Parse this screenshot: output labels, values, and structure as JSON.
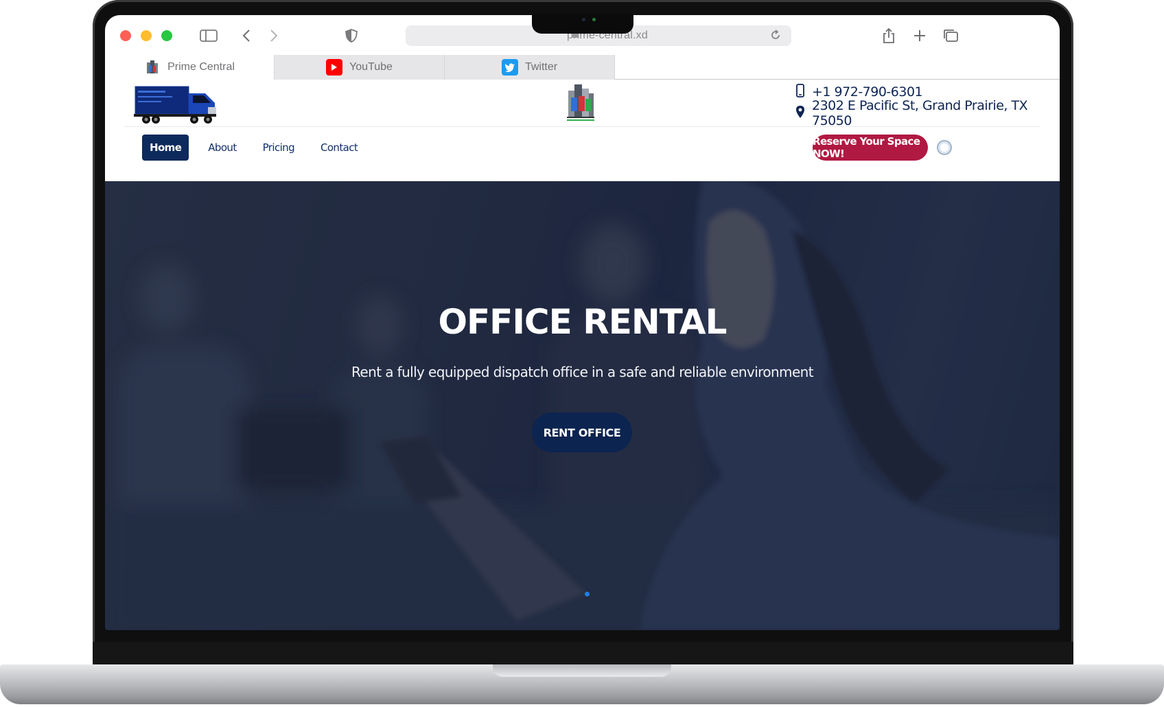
{
  "browser": {
    "url": "prime-central.xd",
    "tabs": [
      {
        "label": "Prime Central",
        "icon": "prime-central-favicon",
        "active": true
      },
      {
        "label": "YouTube",
        "icon": "youtube-favicon",
        "active": false,
        "color": "#ff0000"
      },
      {
        "label": "Twitter",
        "icon": "twitter-favicon",
        "active": false,
        "color": "#1d9bf0"
      }
    ],
    "traffic_lights": [
      "#ff5f57",
      "#febc2e",
      "#28c840"
    ]
  },
  "header": {
    "phone": "+1 972-790-6301",
    "address": "2302 E Pacific St, Grand Prairie, TX 75050",
    "nav": [
      {
        "label": "Home",
        "active": true
      },
      {
        "label": "About",
        "active": false
      },
      {
        "label": "Pricing",
        "active": false
      },
      {
        "label": "Contact",
        "active": false
      }
    ],
    "cta_label": "Reserve Your Space NOW!",
    "cta_color": "#b01942",
    "brand_color": "#0d2a5c"
  },
  "hero": {
    "title": "OFFICE RENTAL",
    "subtitle": "Rent a fully equipped dispatch office in a safe and reliable environment",
    "button_label": "RENT OFFICE",
    "slide_indicator_color": "#1f7ee8"
  }
}
